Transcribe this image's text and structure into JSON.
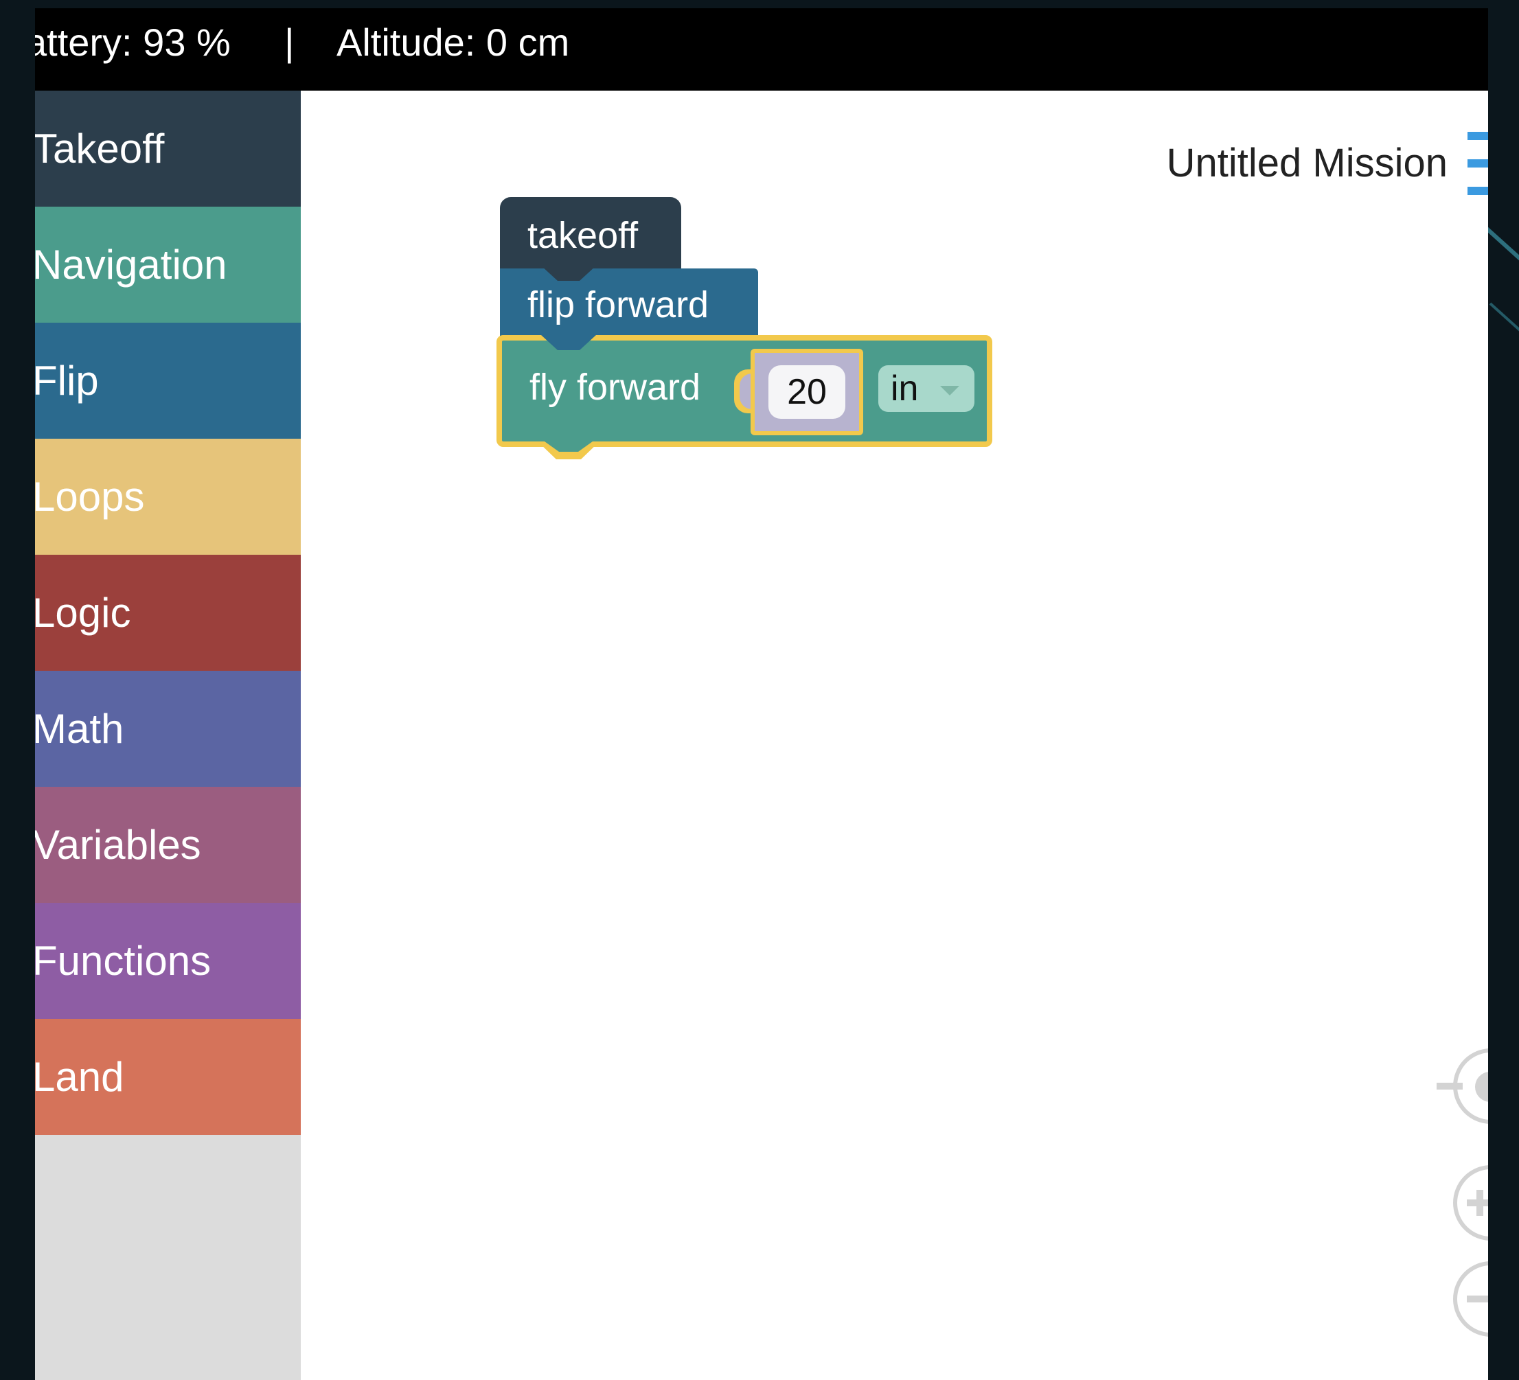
{
  "status": {
    "battery": "attery: 93 %",
    "separator": "|",
    "altitude": "Altitude: 0 cm"
  },
  "sidebar": {
    "categories": [
      {
        "label": "Takeoff",
        "color": "#2c3e4c"
      },
      {
        "label": "Navigation",
        "color": "#4b9c8c"
      },
      {
        "label": "Flip",
        "color": "#2b6a8e"
      },
      {
        "label": "Loops",
        "color": "#e6c47a"
      },
      {
        "label": "Logic",
        "color": "#9b403c"
      },
      {
        "label": "Math",
        "color": "#5b65a3"
      },
      {
        "label": "Variables",
        "color": "#9b5d80"
      },
      {
        "label": "Functions",
        "color": "#8e5da4"
      },
      {
        "label": "Land",
        "color": "#d5735a"
      }
    ]
  },
  "workspace": {
    "mission_title": "Untitled Mission",
    "menu_icon": "hamburger-menu-icon",
    "blocks": {
      "takeoff": "takeoff",
      "flip": "flip forward",
      "fly": {
        "label": "fly forward",
        "distance": "20",
        "unit": "in"
      }
    },
    "selected_outline_color": "#f2c94c",
    "zoom_controls": [
      "reset-zoom-icon",
      "zoom-in-icon",
      "zoom-out-icon"
    ]
  }
}
